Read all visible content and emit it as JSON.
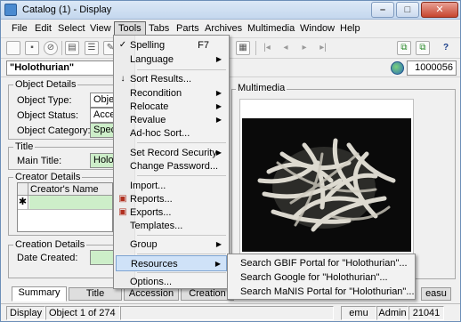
{
  "window": {
    "title": "Catalog (1) - Display",
    "controls": {
      "minimize": "–",
      "maximize": "□",
      "close": "✕"
    }
  },
  "menubar": [
    "File",
    "Edit",
    "Select",
    "View",
    "Tools",
    "Tabs",
    "Parts",
    "Archives",
    "Multimedia",
    "Window",
    "Help"
  ],
  "record": {
    "heading": "\"Holothurian\"",
    "irn": "1000056"
  },
  "object_details": {
    "group_label": "Object Details",
    "type_label": "Object Type:",
    "type_value": "Object",
    "status_label": "Object Status:",
    "status_value": "Access",
    "category_label": "Object Category:",
    "category_value": "Specim"
  },
  "title_group": {
    "group_label": "Title",
    "main_title_label": "Main Title:",
    "main_title_value": "Holoth"
  },
  "creator_details": {
    "group_label": "Creator Details",
    "column_header": "Creator's Name",
    "new_row_marker": "✱"
  },
  "creation_details": {
    "group_label": "Creation Details",
    "date_created_label": "Date Created:"
  },
  "multimedia": {
    "group_label": "Multimedia"
  },
  "tabs": [
    "Summary",
    "Title",
    "Accession",
    "Creation",
    "easu"
  ],
  "status": {
    "mode": "Display",
    "position": "Object 1 of 274",
    "user": "emu",
    "role": "Admin",
    "count": "21041"
  },
  "tools_menu": {
    "items": [
      {
        "label": "Spelling",
        "shortcut": "F7",
        "icon": "spellcheck-icon"
      },
      {
        "label": "Language",
        "submenu": true
      },
      {
        "label": "Sort Results...",
        "icon": "sort-az-icon"
      },
      {
        "label": "Recondition",
        "submenu": true
      },
      {
        "label": "Relocate",
        "submenu": true
      },
      {
        "label": "Revalue",
        "submenu": true
      },
      {
        "label": "Ad-hoc Sort..."
      },
      {
        "label": "Set Record Security",
        "submenu": true
      },
      {
        "label": "Change Password..."
      },
      {
        "label": "Import..."
      },
      {
        "label": "Reports...",
        "icon": "reports-icon"
      },
      {
        "label": "Exports...",
        "icon": "exports-icon"
      },
      {
        "label": "Templates..."
      },
      {
        "label": "Group",
        "submenu": true
      },
      {
        "label": "Resources",
        "submenu": true,
        "highlighted": true
      },
      {
        "label": "Options..."
      }
    ]
  },
  "resources_submenu": [
    "Search GBIF Portal for \"Holothurian\"...",
    "Search Google for \"Holothurian\"...",
    "Search MaNIS Portal for \"Holothurian\"..."
  ]
}
